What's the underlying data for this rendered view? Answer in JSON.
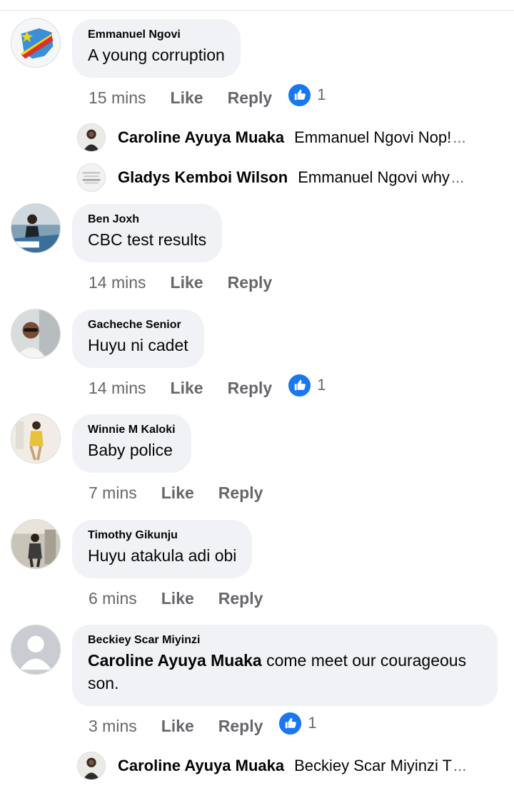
{
  "comments": [
    {
      "author": "Emmanuel Ngovi",
      "text": "A young corruption",
      "time": "15 mins",
      "like_label": "Like",
      "reply_label": "Reply",
      "reaction_count": "1",
      "replies": [
        {
          "author": "Caroline Ayuya Muaka",
          "text": "Emmanuel Ngovi  Nop!",
          "ellipsis": "..."
        },
        {
          "author": "Gladys Kemboi Wilson",
          "text": "Emmanuel Ngovi why",
          "ellipsis": "..."
        }
      ]
    },
    {
      "author": "Ben Joxh",
      "text": "CBC test results",
      "time": "14 mins",
      "like_label": "Like",
      "reply_label": "Reply"
    },
    {
      "author": "Gacheche Senior",
      "text": "Huyu ni cadet",
      "time": "14 mins",
      "like_label": "Like",
      "reply_label": "Reply",
      "reaction_count": "1"
    },
    {
      "author": "Winnie M Kaloki",
      "text": "Baby police",
      "time": "7 mins",
      "like_label": "Like",
      "reply_label": "Reply"
    },
    {
      "author": "Timothy Gikunju",
      "text": "Huyu atakula adi obi",
      "time": "6 mins",
      "like_label": "Like",
      "reply_label": "Reply"
    },
    {
      "author": "Beckiey Scar Miyinzi",
      "mention": "Caroline Ayuya Muaka",
      "text": " come meet our  courageous son.",
      "time": "3 mins",
      "like_label": "Like",
      "reply_label": "Reply",
      "reaction_count": "1",
      "replies": [
        {
          "author": "Caroline Ayuya Muaka",
          "text": "Beckiey Scar Miyinzi T",
          "ellipsis": "..."
        }
      ]
    }
  ],
  "colors": {
    "bubble": "#f0f2f5",
    "meta": "#65676b",
    "like_blue": "#1877f2"
  },
  "icons": {
    "reaction": "thumbs-up-icon",
    "default_avatar": "default-avatar-icon"
  }
}
